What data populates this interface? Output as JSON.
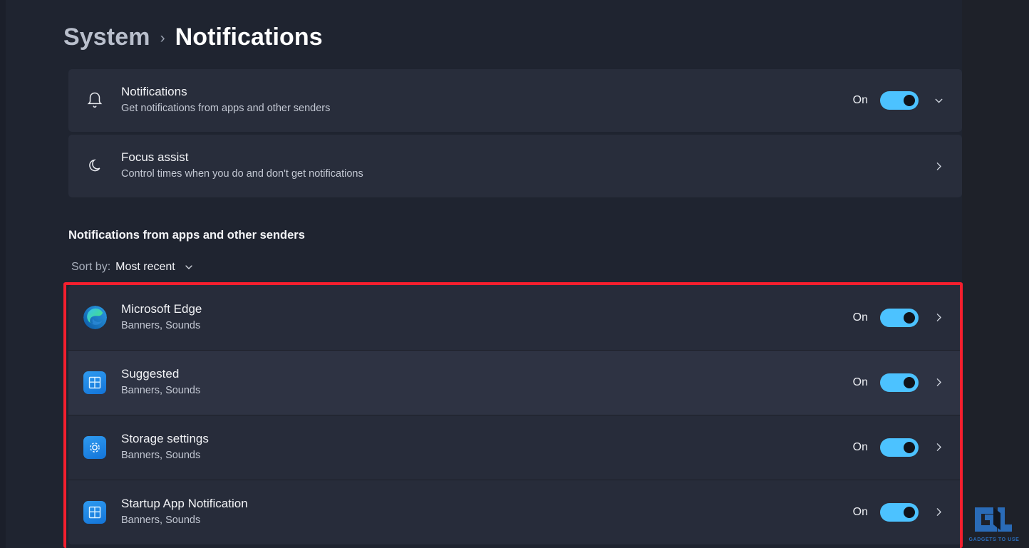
{
  "breadcrumb": {
    "parent": "System",
    "separator": "›",
    "current": "Notifications"
  },
  "cards": [
    {
      "icon": "bell-icon",
      "title": "Notifications",
      "subtitle": "Get notifications from apps and other senders",
      "state": "On",
      "toggle": "on",
      "expander": "chevron-down-icon"
    },
    {
      "icon": "moon-icon",
      "title": "Focus assist",
      "subtitle": "Control times when you do and don't get notifications",
      "state": "",
      "toggle": "none",
      "expander": "chevron-right-icon"
    }
  ],
  "section": {
    "title": "Notifications from apps and other senders",
    "sort_label": "Sort by:",
    "sort_value": "Most recent",
    "sort_chevron": "chevron-down-icon"
  },
  "apps": [
    {
      "icon": "microsoft-edge-icon",
      "name": "Microsoft Edge",
      "subtitle": "Banners, Sounds",
      "state": "On",
      "toggle": "on",
      "chevron": "chevron-right-icon",
      "hover": false
    },
    {
      "icon": "suggested-icon",
      "name": "Suggested",
      "subtitle": "Banners, Sounds",
      "state": "On",
      "toggle": "on",
      "chevron": "chevron-right-icon",
      "hover": true
    },
    {
      "icon": "storage-settings-icon",
      "name": "Storage settings",
      "subtitle": "Banners, Sounds",
      "state": "On",
      "toggle": "on",
      "chevron": "chevron-right-icon",
      "hover": false
    },
    {
      "icon": "startup-app-icon",
      "name": "Startup App Notification",
      "subtitle": "Banners, Sounds",
      "state": "On",
      "toggle": "on",
      "chevron": "chevron-right-icon",
      "hover": false
    }
  ],
  "watermark": {
    "text": "GADGETS TO USE"
  },
  "colors": {
    "page_background": "#1f2430",
    "card_background": "#282d3b",
    "row_hover_background": "#2e3343",
    "accent_toggle": "#4cc2ff",
    "annotation_red": "#f51f2e",
    "icon_blue": "#1f86e8"
  }
}
